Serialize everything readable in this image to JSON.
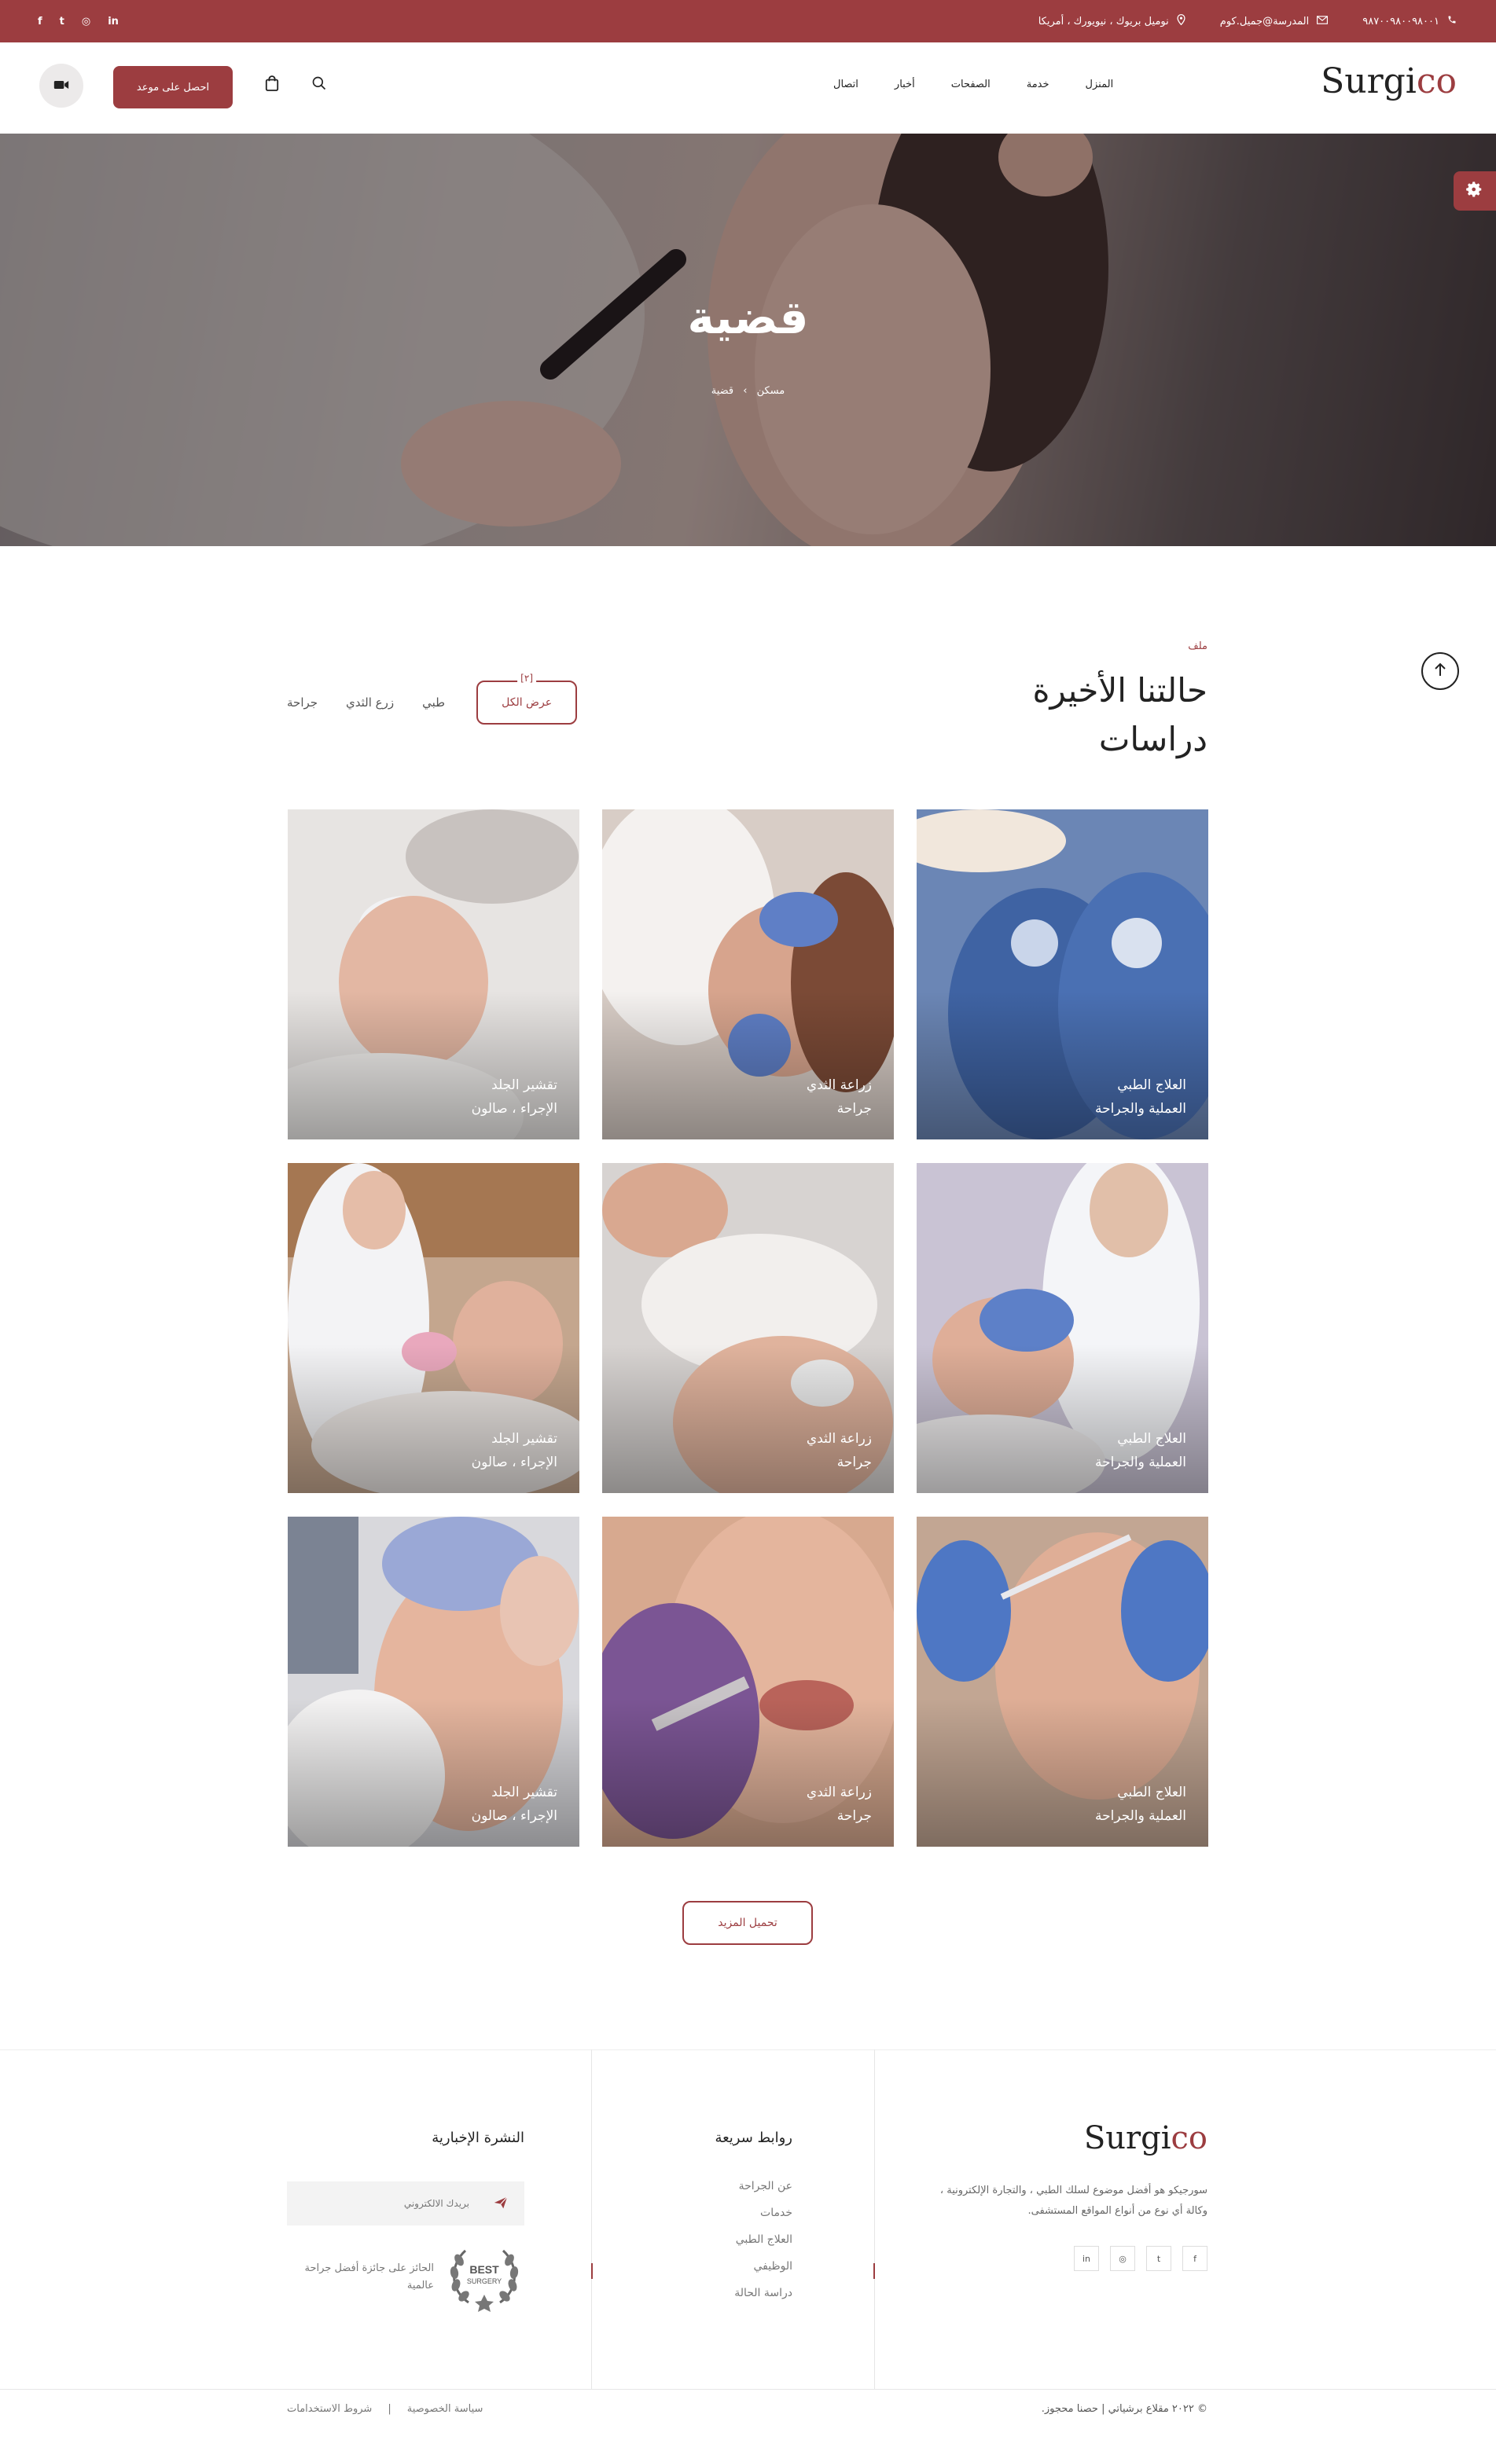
{
  "topbar": {
    "phone": "٩٨٧٠٠٩٨٠٠٩٨٠٠١",
    "email": "المدرسة@جميل.كوم",
    "address": "نوميل بريوك ، نيويورك ، أمريكا",
    "social": [
      "in",
      "◎",
      "t",
      "f"
    ]
  },
  "header": {
    "logo_main": "Surgi",
    "logo_accent": "co",
    "nav": [
      "المنزل",
      "خدمة",
      "الصفحات",
      "أخبار",
      "اتصال"
    ],
    "cta_label": "احصل على موعد"
  },
  "hero": {
    "title": "قضية",
    "crumb_home": "مسكن",
    "crumb_current": "قضية"
  },
  "section": {
    "kicker": "ملف",
    "title_line1": "حالتنا الأخيرة",
    "title_line2": "دراسات",
    "filters": {
      "all_label": "عرض الكل",
      "all_count": "[٢]",
      "medical": "طبي",
      "breast": "زرع الثدي",
      "surgery": "جراحة"
    }
  },
  "cases": [
    {
      "line1": "العلاج الطبي",
      "line2": "العملية والجراحة"
    },
    {
      "line1": "زراعة الثدي",
      "line2": "جراحة"
    },
    {
      "line1": "تقشير الجلد",
      "line2": "الإجراء ، صالون"
    },
    {
      "line1": "العلاج الطبي",
      "line2": "العملية والجراحة"
    },
    {
      "line1": "زراعة الثدي",
      "line2": "جراحة"
    },
    {
      "line1": "تقشير الجلد",
      "line2": "الإجراء ، صالون"
    },
    {
      "line1": "العلاج الطبي",
      "line2": "العملية والجراحة"
    },
    {
      "line1": "زراعة الثدي",
      "line2": "جراحة"
    },
    {
      "line1": "تقشير الجلد",
      "line2": "الإجراء ، صالون"
    }
  ],
  "load_more": "تحميل المزيد",
  "footer": {
    "logo_main": "Surgi",
    "logo_accent": "co",
    "about": "سورجيكو هو أفضل موضوع لسلك الطبي ، والتجارة الإلكترونية ، وكالة أي نوع من أنواع المواقع المستشفى.",
    "social": [
      "f",
      "t",
      "◎",
      "in"
    ],
    "links_title": "روابط سريعة",
    "links": [
      "عن الجراحة",
      "خدمات",
      "العلاج الطبي",
      "الوظيفي",
      "دراسة الحالة"
    ],
    "newsletter_title": "النشرة الإخبارية",
    "newsletter_placeholder": "بريدك الالكتروني",
    "badge_text": "الحائز على جائزة أفضل جراحة عالمية",
    "badge_label1": "BEST",
    "badge_label2": "SURGERY",
    "copyright": "© ٢٠٢٢ مقلاع برشياتي | حصنا محجوز.",
    "privacy": "سياسة الخصوصية",
    "terms": "شروط الاستخدامات",
    "legal_sep": "|"
  },
  "colors": {
    "accent": "#9c3d40"
  }
}
